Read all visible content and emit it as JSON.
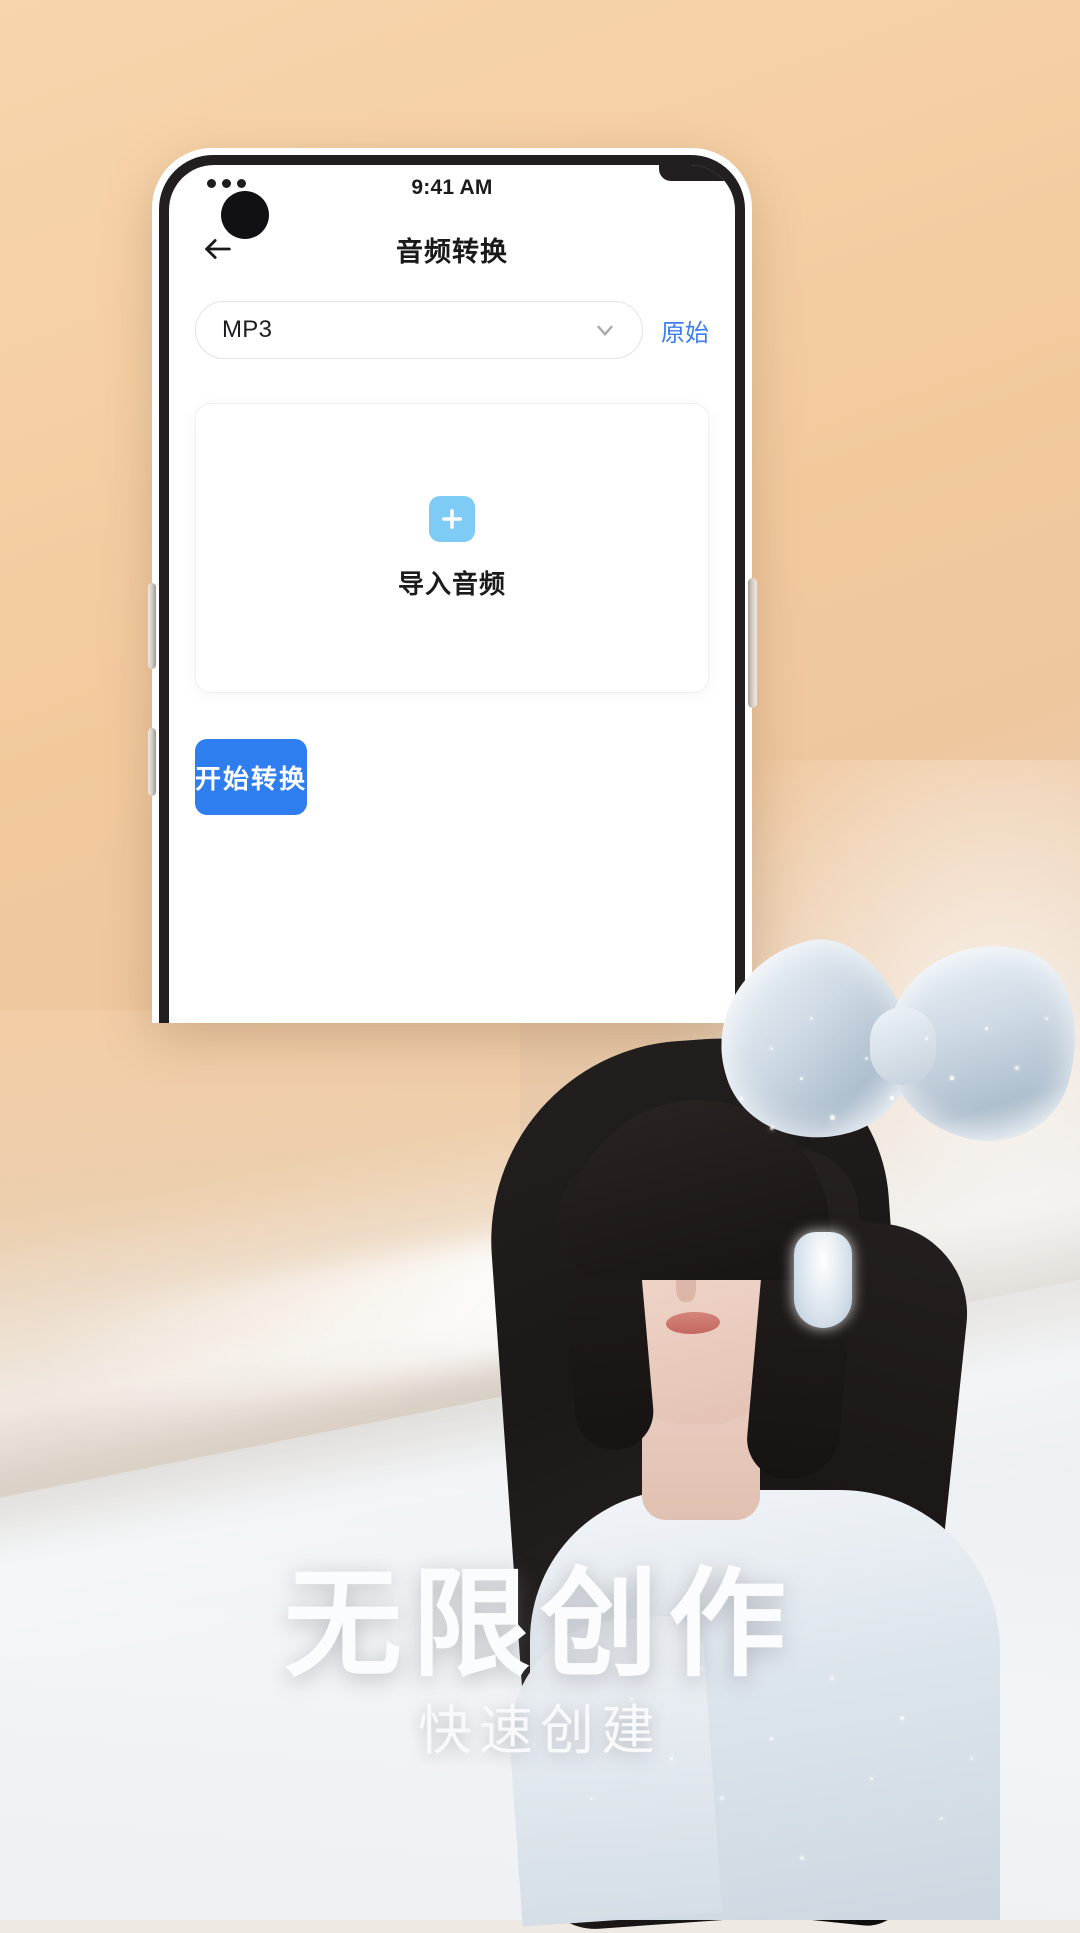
{
  "background": {
    "top_color": "#f6cfa4",
    "bottom_color": "#f2f4f6"
  },
  "phone": {
    "status_bar": {
      "time": "9:41 AM",
      "camera_icon": "punch-hole-camera"
    },
    "header": {
      "back_icon": "arrow-left-icon",
      "title": "音频转换"
    },
    "format_row": {
      "selected_format": "MP3",
      "chevron_icon": "chevron-down-icon",
      "original_label": "原始",
      "original_color": "#3d7df0"
    },
    "import_card": {
      "plus_icon": "plus-icon",
      "plus_icon_color": "#7ecbf5",
      "label": "导入音频"
    },
    "primary_button": {
      "label": "开始转换",
      "color": "#2f7ef0"
    }
  },
  "promo": {
    "headline": "无限创作",
    "subheadline": "快速创建"
  }
}
